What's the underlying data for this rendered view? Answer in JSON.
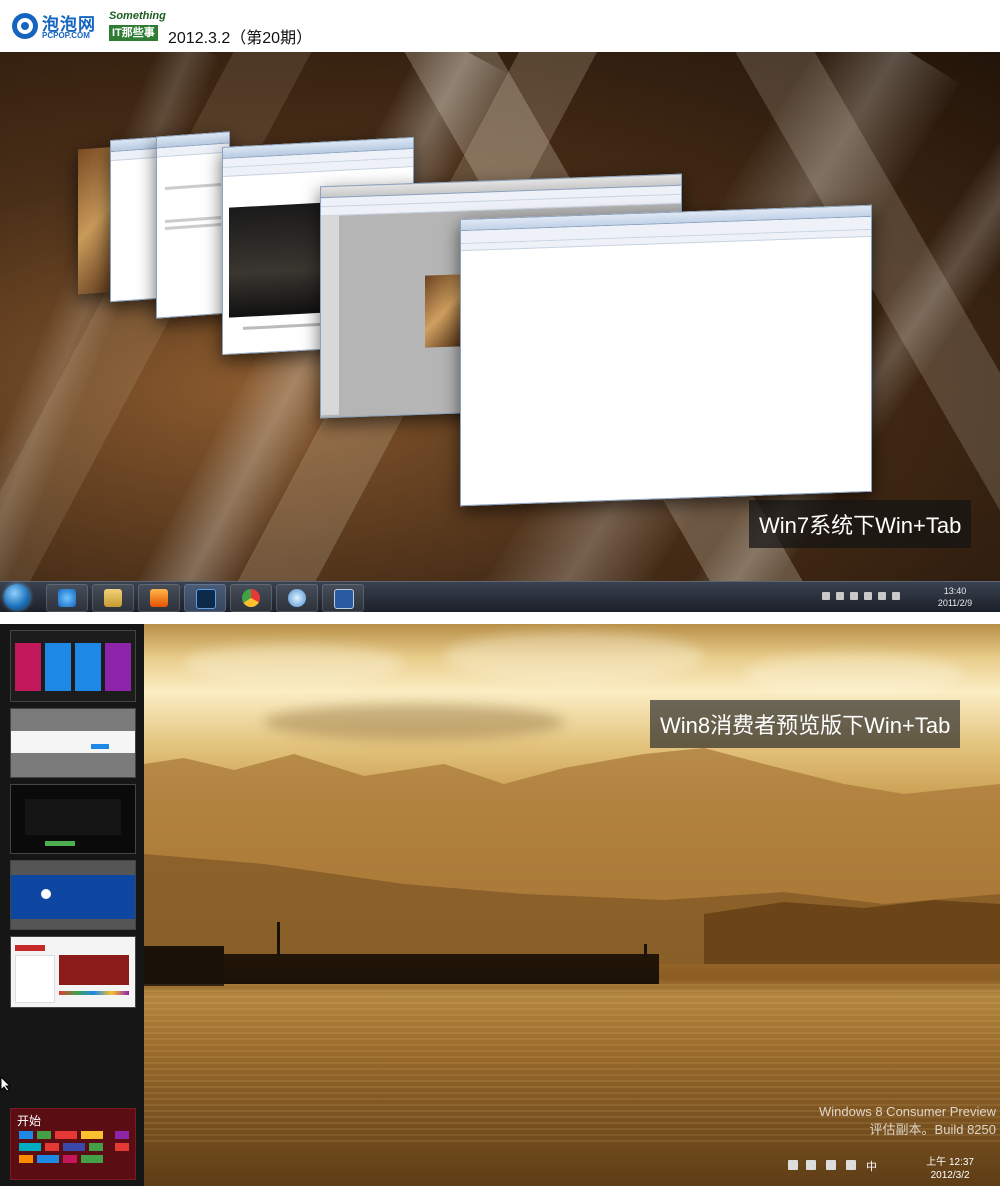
{
  "header": {
    "logo_cn": "泡泡网",
    "logo_en": "PCPOP.COM",
    "logo2_top": "Something",
    "logo2_box": "IT那些事",
    "date": "2012.3.2（第20期）"
  },
  "win7": {
    "caption": "Win7系统下Win+Tab",
    "clock_time": "13:40",
    "clock_date": "2011/2/9",
    "taskbar_apps": [
      "ie-icon",
      "folder-icon",
      "media-player-icon",
      "photoshop-icon",
      "chrome-icon",
      "network-icon",
      "window-icon"
    ]
  },
  "win8": {
    "caption": "Win8消费者预览版下Win+Tab",
    "start_label": "开始",
    "watermark_line1": "Windows 8 Consumer Preview",
    "watermark_line2": "评估副本。Build 8250",
    "clock_time": "上午 12:37",
    "clock_date": "2012/3/2",
    "tray_lang": "中"
  }
}
